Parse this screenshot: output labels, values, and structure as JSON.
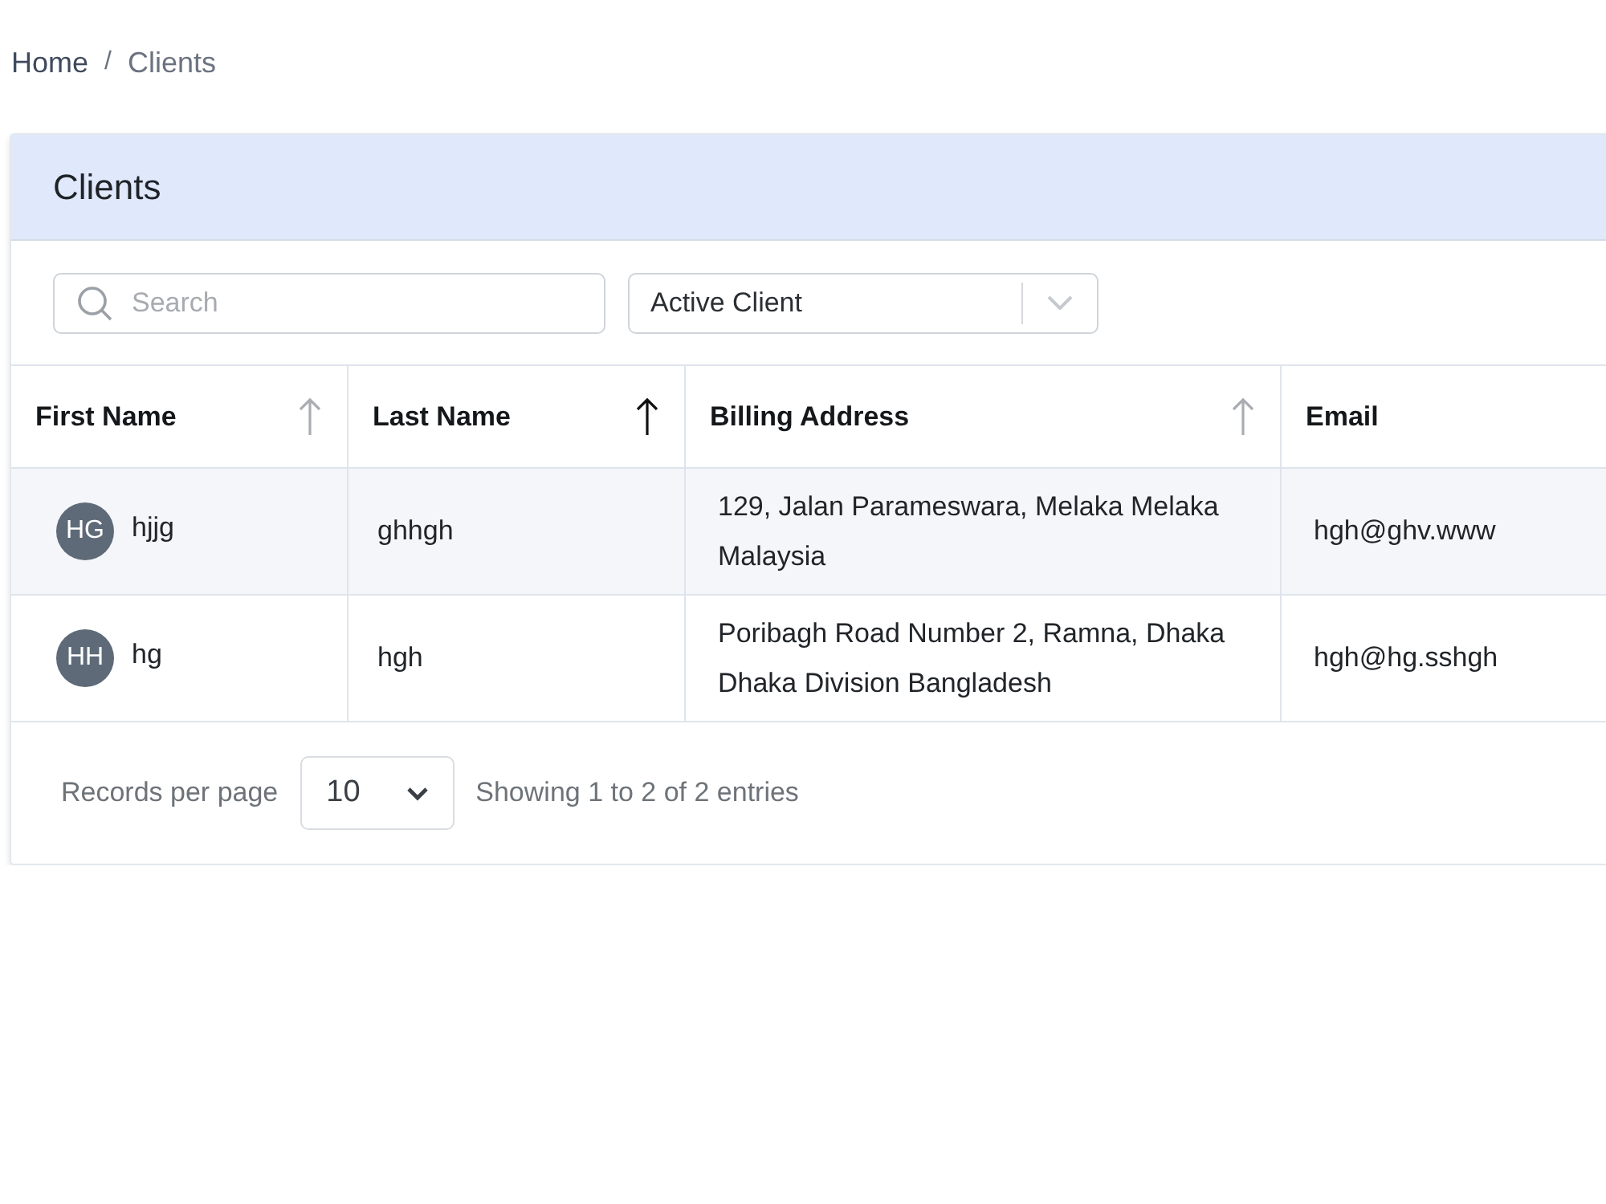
{
  "breadcrumb": {
    "separator": "/",
    "items": [
      {
        "label": "Home",
        "current": false
      },
      {
        "label": "Clients",
        "current": true
      }
    ]
  },
  "card": {
    "title": "Clients"
  },
  "filters": {
    "search": {
      "placeholder": "Search"
    },
    "status_select": {
      "value": "Active Client"
    }
  },
  "table": {
    "columns": [
      {
        "label": "First Name",
        "sort_active": false
      },
      {
        "label": "Last Name",
        "sort_active": true
      },
      {
        "label": "Billing Address",
        "sort_active": false
      },
      {
        "label": "Email"
      }
    ],
    "rows": [
      {
        "initials": "HG",
        "first_name": "hjjg",
        "last_name": "ghhgh",
        "billing_address": "129, Jalan Parameswara, Melaka Melaka Malaysia",
        "email": "hgh@ghv.www"
      },
      {
        "initials": "HH",
        "first_name": "hg",
        "last_name": "hgh",
        "billing_address": "Poribagh Road Number 2, Ramna, Dhaka Dhaka Division Bangladesh",
        "email": "hgh@hg.sshgh"
      }
    ]
  },
  "footer": {
    "records_label": "Records per page",
    "page_size": "10",
    "summary": "Showing 1 to 2 of 2 entries"
  }
}
